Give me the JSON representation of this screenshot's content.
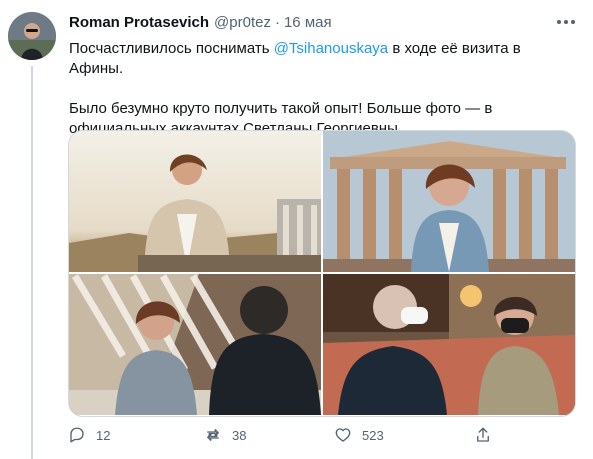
{
  "author": {
    "name": "Roman Protasevich",
    "handle": "@pr0tez",
    "separator": "·",
    "date": "16 мая"
  },
  "tweet": {
    "text_before_mention": "Посчастливилось поснимать ",
    "mention": "@Tsihanouskaya",
    "text_after_mention": " в ходе её визита в Афины.",
    "second_paragraph": "Было безумно круто получить такой опыт! Больше фото — в официальных аккаунтах Светланы Георгиевны."
  },
  "actions": {
    "replies": "12",
    "retweets": "38",
    "likes": "523"
  },
  "icons": [
    "more-icon",
    "reply-icon",
    "retweet-icon",
    "like-icon",
    "share-icon"
  ],
  "colors": {
    "link": "#1d9bf0",
    "muted": "#536471",
    "border": "#cfd9de"
  }
}
